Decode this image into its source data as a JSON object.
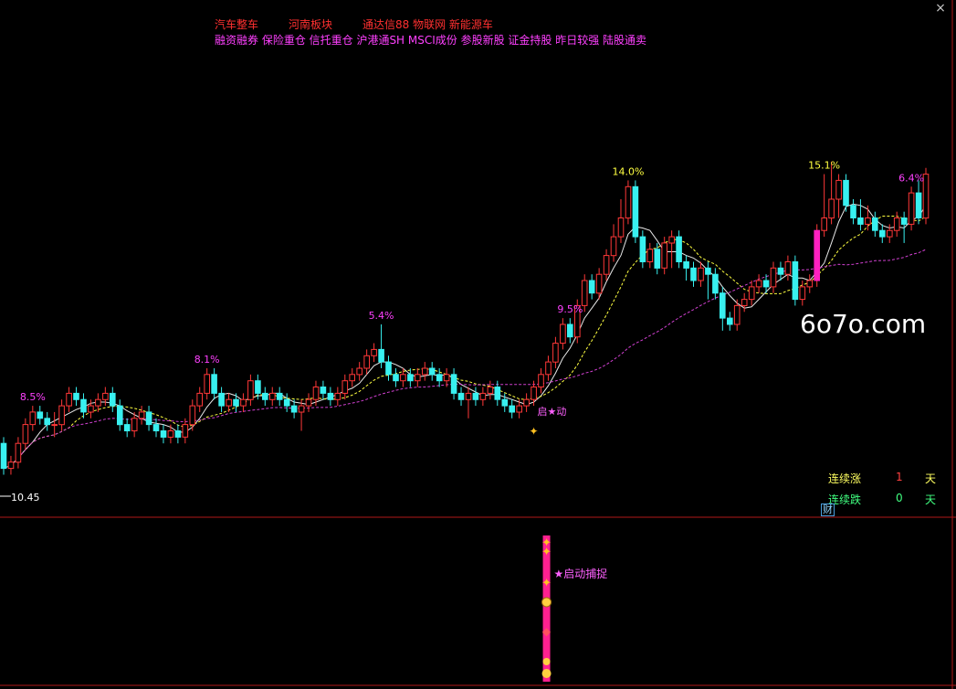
{
  "header": {
    "line1": [
      "汽车整车",
      "河南板块",
      "通达信88 物联网 新能源车"
    ],
    "line2": "融资融券 保险重仓 信托重仓 沪港通SH MSCI成份 参股新股 证金持股 昨日较强 陆股通卖"
  },
  "window": {
    "close_icon": "×"
  },
  "stats": {
    "up_label": "连续涨",
    "up_value": "1",
    "up_unit": "天",
    "down_label": "连续跌",
    "down_value": "0",
    "down_unit": "天",
    "badge": "财"
  },
  "watermark": "6o7o.com",
  "chart_data": {
    "type": "candlestick",
    "price_range": [
      10.2,
      15.6
    ],
    "low_marker": "10.45",
    "peak_labels": [
      {
        "index": 4,
        "text": "8.5%"
      },
      {
        "index": 28,
        "text": "8.1%"
      },
      {
        "index": 52,
        "text": "5.4%"
      },
      {
        "index": 78,
        "text": "9.5%"
      },
      {
        "index": 86,
        "text": "14.0%"
      },
      {
        "index": 113,
        "text": "15.1%"
      },
      {
        "index": 125,
        "text": "6.4%"
      }
    ],
    "signal_label": "启★动",
    "signal_index": 73,
    "indicator_label": "★启动捕捉",
    "candles": [
      [
        11.0,
        10.6,
        11.1,
        10.5
      ],
      [
        10.6,
        10.7,
        10.8,
        10.5
      ],
      [
        10.7,
        11.0,
        11.1,
        10.6
      ],
      [
        11.0,
        11.3,
        11.4,
        10.9
      ],
      [
        11.3,
        11.5,
        11.6,
        11.2
      ],
      [
        11.5,
        11.4,
        11.6,
        11.3
      ],
      [
        11.4,
        11.3,
        11.5,
        11.2
      ],
      [
        11.3,
        11.3,
        11.5,
        11.1
      ],
      [
        11.3,
        11.6,
        11.7,
        11.2
      ],
      [
        11.6,
        11.8,
        11.9,
        11.5
      ],
      [
        11.8,
        11.7,
        11.9,
        11.6
      ],
      [
        11.7,
        11.5,
        11.8,
        11.4
      ],
      [
        11.5,
        11.6,
        11.7,
        11.4
      ],
      [
        11.6,
        11.7,
        11.8,
        11.5
      ],
      [
        11.7,
        11.8,
        11.9,
        11.6
      ],
      [
        11.8,
        11.6,
        11.9,
        11.5
      ],
      [
        11.6,
        11.3,
        11.7,
        11.2
      ],
      [
        11.3,
        11.2,
        11.4,
        11.1
      ],
      [
        11.2,
        11.4,
        11.5,
        11.1
      ],
      [
        11.4,
        11.5,
        11.6,
        11.3
      ],
      [
        11.5,
        11.3,
        11.6,
        11.2
      ],
      [
        11.3,
        11.2,
        11.4,
        11.1
      ],
      [
        11.2,
        11.1,
        11.3,
        11.0
      ],
      [
        11.1,
        11.2,
        11.3,
        11.0
      ],
      [
        11.2,
        11.1,
        11.3,
        11.0
      ],
      [
        11.1,
        11.3,
        11.4,
        11.0
      ],
      [
        11.3,
        11.6,
        11.7,
        11.2
      ],
      [
        11.6,
        11.8,
        11.9,
        11.5
      ],
      [
        11.8,
        12.1,
        12.2,
        11.7
      ],
      [
        12.1,
        11.8,
        12.2,
        11.7
      ],
      [
        11.8,
        11.6,
        11.9,
        11.5
      ],
      [
        11.6,
        11.7,
        11.8,
        11.5
      ],
      [
        11.7,
        11.6,
        11.8,
        11.5
      ],
      [
        11.6,
        11.7,
        11.8,
        11.5
      ],
      [
        11.7,
        12.0,
        12.1,
        11.6
      ],
      [
        12.0,
        11.8,
        12.1,
        11.7
      ],
      [
        11.8,
        11.7,
        11.9,
        11.6
      ],
      [
        11.7,
        11.8,
        11.9,
        11.6
      ],
      [
        11.8,
        11.7,
        11.9,
        11.6
      ],
      [
        11.7,
        11.6,
        11.8,
        11.5
      ],
      [
        11.6,
        11.5,
        11.7,
        11.4
      ],
      [
        11.5,
        11.6,
        11.7,
        11.2
      ],
      [
        11.6,
        11.7,
        11.8,
        11.5
      ],
      [
        11.7,
        11.9,
        12.0,
        11.6
      ],
      [
        11.9,
        11.8,
        12.0,
        11.7
      ],
      [
        11.8,
        11.7,
        11.9,
        11.6
      ],
      [
        11.7,
        11.8,
        11.9,
        11.6
      ],
      [
        11.8,
        12.0,
        12.1,
        11.7
      ],
      [
        12.0,
        12.1,
        12.2,
        11.9
      ],
      [
        12.1,
        12.2,
        12.3,
        12.0
      ],
      [
        12.2,
        12.4,
        12.5,
        12.1
      ],
      [
        12.4,
        12.5,
        12.6,
        12.3
      ],
      [
        12.5,
        12.3,
        12.9,
        12.2
      ],
      [
        12.3,
        12.1,
        12.4,
        12.0
      ],
      [
        12.1,
        12.0,
        12.2,
        11.9
      ],
      [
        12.0,
        12.1,
        12.2,
        11.9
      ],
      [
        12.1,
        12.0,
        12.2,
        11.9
      ],
      [
        12.0,
        12.1,
        12.2,
        11.9
      ],
      [
        12.1,
        12.2,
        12.3,
        12.0
      ],
      [
        12.2,
        12.1,
        12.3,
        12.0
      ],
      [
        12.1,
        12.0,
        12.2,
        11.9
      ],
      [
        12.0,
        12.1,
        12.2,
        11.9
      ],
      [
        12.1,
        11.8,
        12.2,
        11.7
      ],
      [
        11.8,
        11.7,
        11.9,
        11.6
      ],
      [
        11.7,
        11.8,
        11.9,
        11.4
      ],
      [
        11.8,
        11.7,
        11.9,
        11.6
      ],
      [
        11.7,
        11.8,
        11.9,
        11.6
      ],
      [
        11.8,
        11.9,
        12.0,
        11.7
      ],
      [
        11.9,
        11.7,
        12.0,
        11.6
      ],
      [
        11.7,
        11.6,
        11.8,
        11.5
      ],
      [
        11.6,
        11.5,
        11.7,
        11.4
      ],
      [
        11.5,
        11.6,
        11.7,
        11.4
      ],
      [
        11.6,
        11.7,
        11.8,
        11.5
      ],
      [
        11.7,
        11.9,
        12.0,
        11.6
      ],
      [
        11.9,
        12.1,
        12.2,
        11.8
      ],
      [
        12.1,
        12.3,
        12.4,
        12.0
      ],
      [
        12.3,
        12.6,
        12.7,
        12.2
      ],
      [
        12.6,
        12.9,
        13.0,
        12.5
      ],
      [
        12.9,
        12.7,
        13.0,
        12.6
      ],
      [
        12.7,
        13.2,
        13.3,
        12.6
      ],
      [
        13.2,
        13.6,
        13.7,
        13.1
      ],
      [
        13.6,
        13.4,
        13.7,
        13.3
      ],
      [
        13.4,
        13.7,
        13.8,
        13.3
      ],
      [
        13.7,
        14.0,
        14.1,
        13.6
      ],
      [
        14.0,
        14.3,
        14.5,
        13.9
      ],
      [
        14.3,
        14.6,
        14.9,
        14.2
      ],
      [
        14.6,
        15.1,
        15.2,
        14.5
      ],
      [
        15.1,
        14.3,
        15.2,
        14.2
      ],
      [
        14.3,
        13.9,
        14.4,
        13.8
      ],
      [
        13.9,
        14.1,
        14.2,
        13.8
      ],
      [
        14.1,
        13.8,
        14.2,
        13.7
      ],
      [
        13.8,
        14.2,
        14.3,
        13.7
      ],
      [
        14.2,
        14.3,
        14.4,
        13.8
      ],
      [
        14.3,
        13.9,
        14.4,
        13.8
      ],
      [
        13.9,
        13.8,
        14.0,
        13.6
      ],
      [
        13.8,
        13.6,
        13.9,
        13.5
      ],
      [
        13.6,
        13.8,
        13.9,
        13.5
      ],
      [
        13.8,
        13.7,
        13.9,
        13.3
      ],
      [
        13.7,
        13.4,
        13.8,
        13.3
      ],
      [
        13.4,
        13.0,
        13.5,
        12.8
      ],
      [
        13.0,
        12.9,
        13.1,
        12.8
      ],
      [
        12.9,
        13.2,
        13.3,
        12.8
      ],
      [
        13.2,
        13.3,
        13.4,
        13.1
      ],
      [
        13.3,
        13.5,
        13.6,
        13.2
      ],
      [
        13.5,
        13.6,
        13.7,
        13.4
      ],
      [
        13.6,
        13.5,
        13.7,
        13.4
      ],
      [
        13.5,
        13.8,
        13.9,
        13.4
      ],
      [
        13.8,
        13.7,
        13.9,
        13.6
      ],
      [
        13.7,
        13.9,
        14.0,
        13.6
      ],
      [
        13.9,
        13.3,
        14.0,
        13.2
      ],
      [
        13.3,
        13.5,
        13.6,
        13.2
      ],
      [
        13.5,
        13.6,
        13.7,
        13.4
      ],
      [
        13.6,
        14.4,
        14.5,
        13.5
      ],
      [
        14.4,
        14.6,
        15.3,
        14.3
      ],
      [
        14.6,
        14.9,
        15.5,
        14.5
      ],
      [
        14.9,
        15.2,
        15.3,
        14.6
      ],
      [
        15.2,
        14.8,
        15.3,
        14.7
      ],
      [
        14.8,
        14.6,
        14.9,
        14.5
      ],
      [
        14.6,
        14.5,
        14.9,
        14.4
      ],
      [
        14.5,
        14.6,
        14.8,
        14.4
      ],
      [
        14.6,
        14.4,
        14.7,
        14.3
      ],
      [
        14.4,
        14.3,
        14.5,
        14.2
      ],
      [
        14.3,
        14.4,
        14.5,
        14.2
      ],
      [
        14.4,
        14.6,
        14.7,
        14.3
      ],
      [
        14.6,
        14.5,
        14.7,
        14.2
      ],
      [
        14.5,
        15.0,
        15.1,
        14.4
      ],
      [
        15.0,
        14.6,
        15.2,
        14.5
      ],
      [
        14.6,
        15.3,
        15.4,
        14.5
      ]
    ]
  }
}
